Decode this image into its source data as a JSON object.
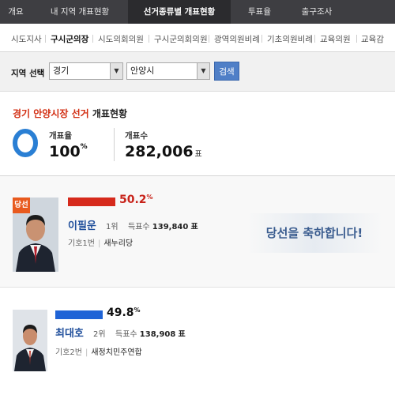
{
  "top_nav": {
    "tabs": [
      {
        "label": "개요",
        "active": false
      },
      {
        "label": "내 지역 개표현황",
        "active": false
      },
      {
        "label": "선거종류별 개표현황",
        "active": true
      },
      {
        "label": "투표율",
        "active": false
      },
      {
        "label": "출구조사",
        "active": false
      }
    ]
  },
  "sub_nav": {
    "items": [
      {
        "label": "시도지사",
        "active": false
      },
      {
        "label": "구시군의장",
        "active": true
      },
      {
        "label": "시도의회의원",
        "active": false
      },
      {
        "label": "구시군의회의원",
        "active": false
      },
      {
        "label": "광역의원비례",
        "active": false
      },
      {
        "label": "기초의원비례",
        "active": false
      },
      {
        "label": "교육의원",
        "active": false
      },
      {
        "label": "교육감",
        "active": false
      }
    ]
  },
  "filter": {
    "label": "지역 선택",
    "province_value": "경기",
    "city_value": "안양시",
    "search_label": "검색"
  },
  "summary": {
    "title_highlight": "경기 안양시장 선거",
    "title_rest": " 개표현황",
    "turnout_label": "개표율",
    "turnout_value": "100",
    "turnout_unit": "%",
    "turnout_fraction": 1.0,
    "count_label": "개표수",
    "count_value": "282,006",
    "count_unit": "표"
  },
  "candidates": [
    {
      "winner_badge": "당선",
      "percent": "50.2",
      "percent_unit": "%",
      "percent_value": 50.2,
      "bar_color": "#d62a1c",
      "name": "이필운",
      "rank": "1위",
      "votes_label": "득표수",
      "votes": "139,840",
      "votes_unit": "표",
      "number_label": "기호1번",
      "party": "새누리당",
      "congrats": "당선을 축하합니다!"
    },
    {
      "percent": "49.8",
      "percent_unit": "%",
      "percent_value": 49.8,
      "bar_color": "#1f63d6",
      "name": "최대호",
      "rank": "2위",
      "votes_label": "득표수",
      "votes": "138,908",
      "votes_unit": "표",
      "number_label": "기호2번",
      "party": "새정치민주연합"
    }
  ],
  "colors": {
    "accent_red": "#d22e12",
    "accent_blue": "#1f63d6",
    "donut_blue": "#2a7fd4",
    "winner_orange": "#e85a1e"
  }
}
